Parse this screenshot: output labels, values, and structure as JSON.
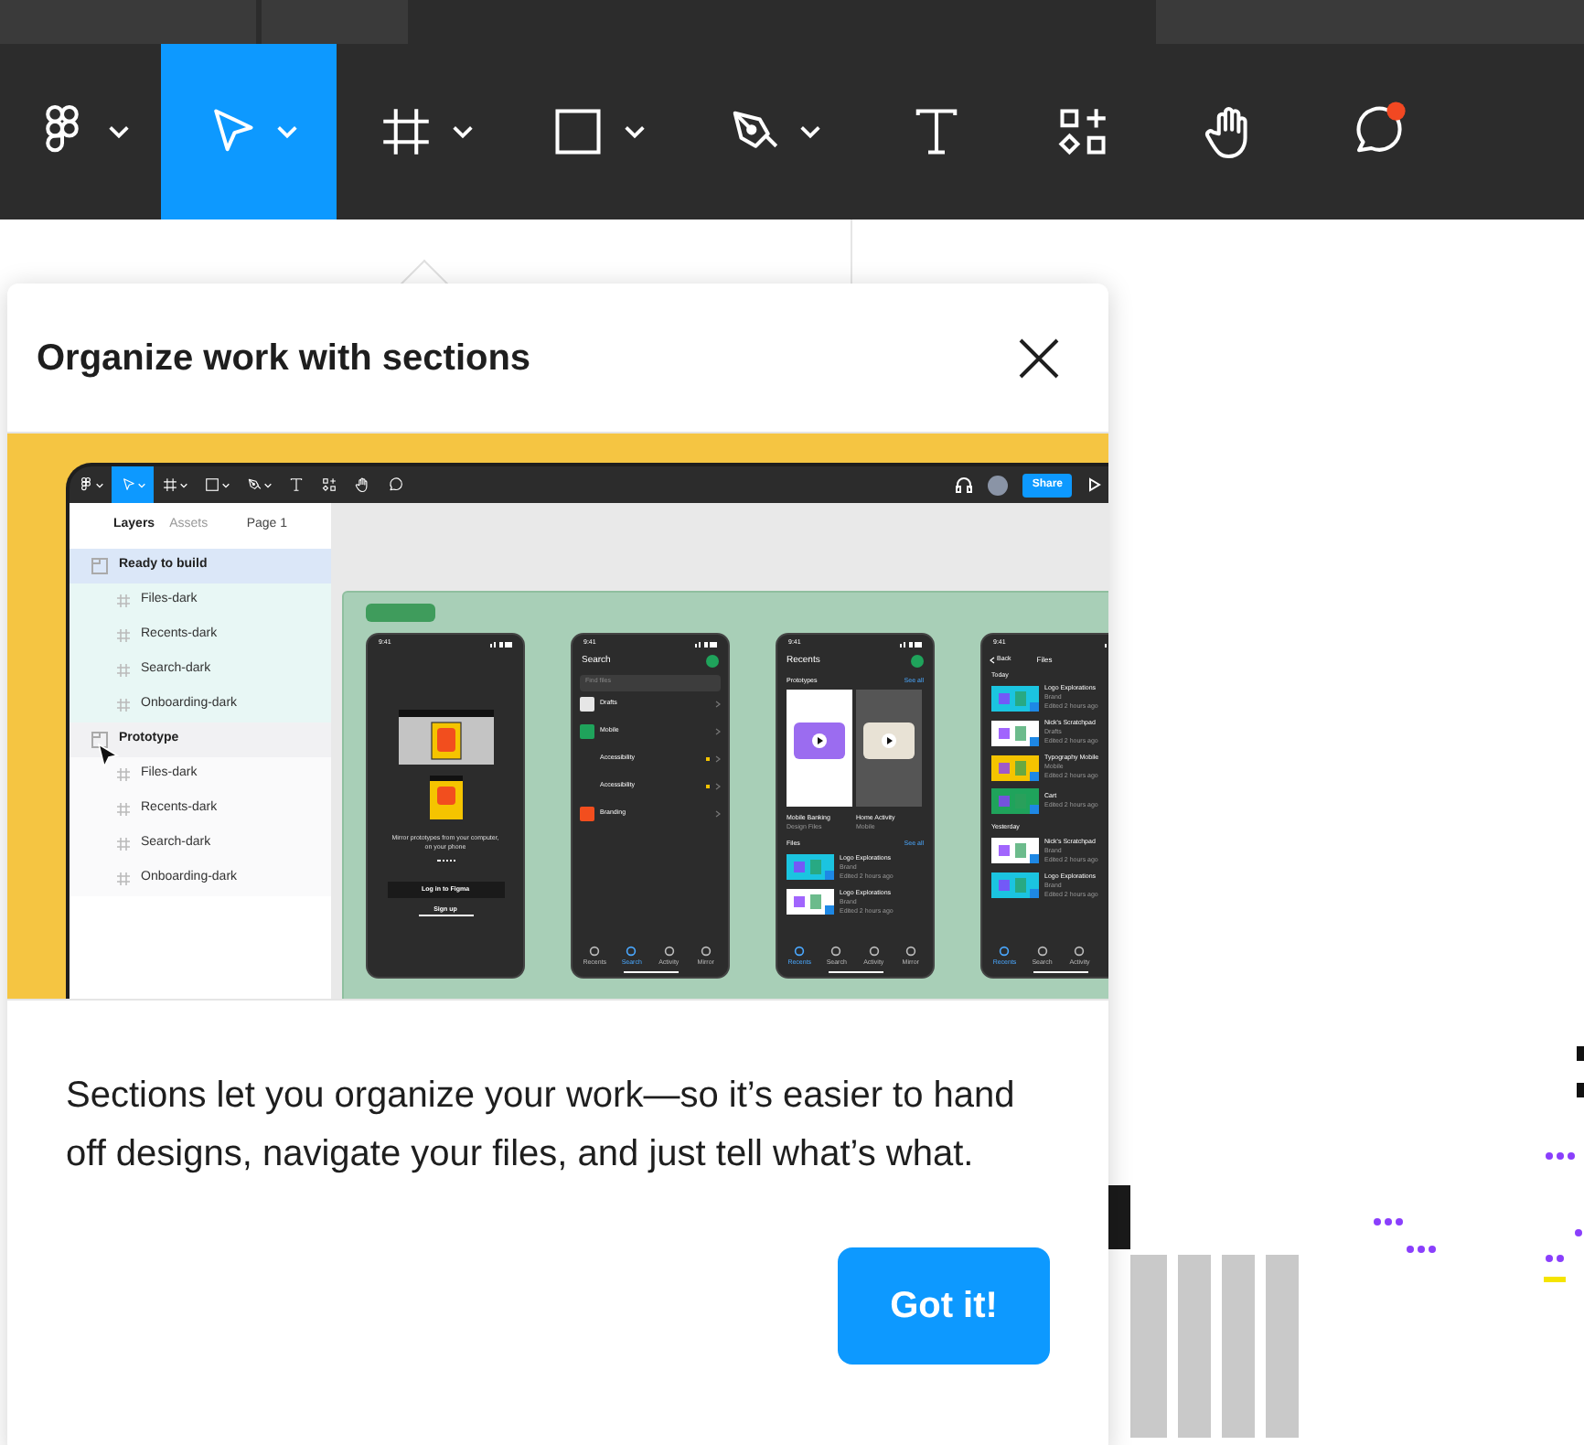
{
  "toolbar": {
    "tools": [
      {
        "kind": "figma",
        "selected": false,
        "dropdown": true
      },
      {
        "kind": "move",
        "selected": true,
        "dropdown": true
      },
      {
        "kind": "frame",
        "selected": false,
        "dropdown": true
      },
      {
        "kind": "shape",
        "selected": false,
        "dropdown": true
      },
      {
        "kind": "pen",
        "selected": false,
        "dropdown": true
      },
      {
        "kind": "text",
        "selected": false
      },
      {
        "kind": "resources",
        "selected": false
      },
      {
        "kind": "hand",
        "selected": false
      },
      {
        "kind": "comment",
        "selected": false,
        "notification": true
      }
    ]
  },
  "popover": {
    "title": "Organize work with sections",
    "body": "Sections let you organize your work—so it’s easier to hand off designs, navigate your files, and just tell what’s what.",
    "button": "Got it!",
    "illustration": {
      "sidebar_tabs": [
        {
          "label": "Layers",
          "selected": true
        },
        {
          "label": "Assets",
          "selected": false
        }
      ],
      "page": "Page 1",
      "sections": [
        {
          "name": "Ready to build",
          "selected": true,
          "children": [
            "Files-dark",
            "Recents-dark",
            "Search-dark",
            "Onboarding-dark"
          ]
        },
        {
          "name": "Prototype",
          "selected": false,
          "children": [
            "Files-dark",
            "Recents-dark",
            "Search-dark",
            "Onboarding-dark"
          ]
        }
      ],
      "share": "Share",
      "phones": [
        {
          "kind": "onboarding",
          "time": "9:41",
          "caption": "Mirror prototypes from your computer, on your phone",
          "primary": "Log in to Figma",
          "secondary": "Sign up"
        },
        {
          "kind": "search",
          "time": "9:41",
          "title": "Search",
          "placeholder": "Find files",
          "rows": [
            {
              "label": "Drafts",
              "color": "#e6e6e6",
              "flagged": false
            },
            {
              "label": "Mobile",
              "color": "#1fa35b",
              "flagged": false
            },
            {
              "label": "Accessibility",
              "flagged": true
            },
            {
              "label": "Accessibility",
              "flagged": true
            },
            {
              "label": "Branding",
              "color": "#f24e1e",
              "flagged": false
            }
          ],
          "nav": [
            {
              "label": "Recents",
              "selected": false
            },
            {
              "label": "Search",
              "selected": true
            },
            {
              "label": "Activity",
              "selected": false
            },
            {
              "label": "Mirror",
              "selected": false
            }
          ]
        },
        {
          "kind": "recents",
          "time": "9:41",
          "title": "Recents",
          "prototypes_heading": "Prototypes",
          "prototypes_link": "See all",
          "cards": [
            {
              "title": "Mobile Banking",
              "subtitle": "Design Files"
            },
            {
              "title": "Home Activity",
              "subtitle": "Mobile"
            }
          ],
          "files_heading": "Files",
          "files_link": "See all",
          "files": [
            {
              "title": "Logo Explorations",
              "subtitle": "Brand",
              "time": "Edited 2 hours ago",
              "color": "#1bc4e0"
            },
            {
              "title": "Logo Explorations",
              "subtitle": "Brand",
              "time": "Edited 2 hours ago",
              "color": "#ffffff"
            }
          ],
          "nav": [
            {
              "label": "Recents",
              "selected": true
            },
            {
              "label": "Search",
              "selected": false
            },
            {
              "label": "Activity",
              "selected": false
            },
            {
              "label": "Mirror",
              "selected": false
            }
          ]
        },
        {
          "kind": "files",
          "time": "9:41",
          "back": "Back",
          "title": "Files",
          "groups": [
            {
              "heading": "Today",
              "files": [
                {
                  "title": "Logo Explorations",
                  "subtitle": "Brand",
                  "time": "Edited 2 hours ago",
                  "color": "#1bc4e0"
                },
                {
                  "title": "Nick's Scratchpad",
                  "subtitle": "Drafts",
                  "time": "Edited 2 hours ago",
                  "color": "#ffffff"
                },
                {
                  "title": "Typography Mobile",
                  "subtitle": "Mobile",
                  "time": "Edited 2 hours ago",
                  "color": "#f5c400"
                },
                {
                  "title": "Cart",
                  "time": "Edited 2 hours ago",
                  "color": "#1fa35b"
                }
              ]
            },
            {
              "heading": "Yesterday",
              "files": [
                {
                  "title": "Nick's Scratchpad",
                  "subtitle": "Brand",
                  "time": "Edited 2 hours ago",
                  "color": "#ffffff"
                },
                {
                  "title": "Logo Explorations",
                  "subtitle": "Brand",
                  "time": "Edited 2 hours ago",
                  "color": "#1bc4e0"
                }
              ]
            }
          ],
          "nav": [
            {
              "label": "Recents",
              "selected": true
            },
            {
              "label": "Search",
              "selected": false
            },
            {
              "label": "Activity",
              "selected": false
            }
          ]
        }
      ]
    }
  }
}
